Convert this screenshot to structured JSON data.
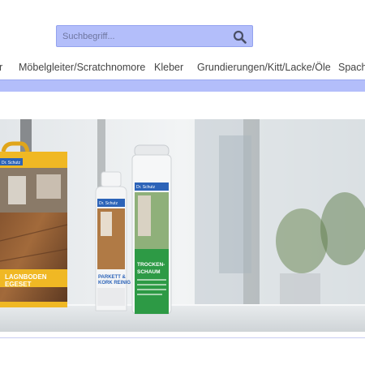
{
  "search": {
    "placeholder": "Suchbegriff...",
    "value": ""
  },
  "icons": {
    "search": "search-icon"
  },
  "nav": {
    "items": [
      "r",
      "Möbelgleiter/Scratchnomore",
      "Kleber",
      "Grundierungen/Kitt/Lacke/Öle",
      "Spacht"
    ]
  },
  "banner": {
    "products": {
      "box": {
        "brand": "Dr. Schutz",
        "label_line1": "LAGNBODEN",
        "label_line2": "EGESET"
      },
      "bottle": {
        "brand": "Dr. Schutz",
        "label_line1": "PARKETT &",
        "label_line2": "KORK REINIG"
      },
      "can": {
        "brand": "Dr. Schutz",
        "label_line1": "TROCKEN-",
        "label_line2": "SCHAUM"
      }
    }
  },
  "colors": {
    "accent": "#b3befa",
    "accent_border": "#93a2ef",
    "product_green": "#2d9a45"
  }
}
